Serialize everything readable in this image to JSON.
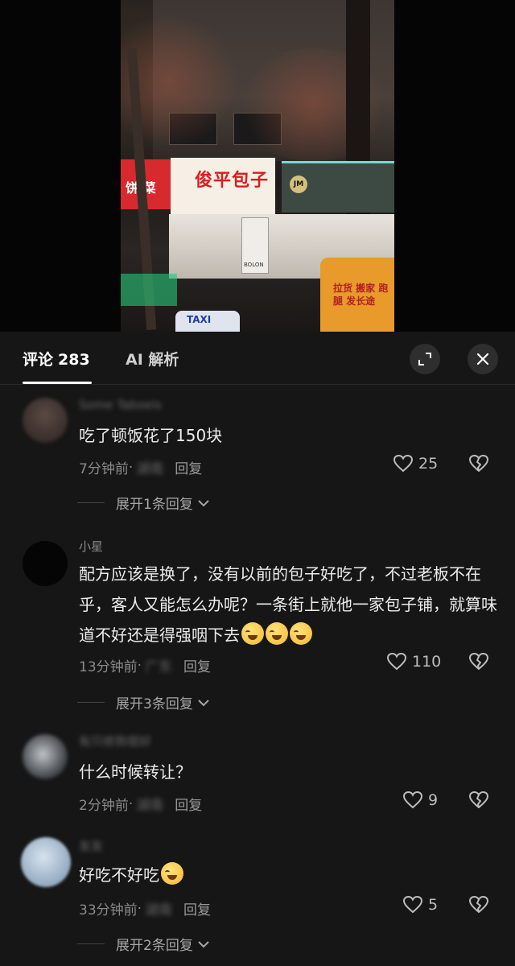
{
  "video": {
    "shop_sign": "俊平包子",
    "side_sign": "饼 菜",
    "jm_logo": "JM",
    "poster_text": "BOLON",
    "taxi_label": "TAXI",
    "bus_text": "拉货 搬家 跑腿 发长途"
  },
  "tabs": {
    "comments_label": "评论",
    "comments_count": "283",
    "ai_label": "AI 解析"
  },
  "comments": [
    {
      "user": "Some Taboeis",
      "text": "吃了顿饭花了150块",
      "time": "7分钟前",
      "location": "湖南",
      "reply_label": "回复",
      "likes": "25",
      "expand_label": "展开1条回复"
    },
    {
      "user": "小星",
      "text": "配方应该是换了，没有以前的包子好吃了，不过老板不在乎，客人又能怎么办呢？一条街上就他一家包子铺，就算味道不好还是得强咽下去",
      "time": "13分钟前",
      "location": "广东",
      "reply_label": "回复",
      "likes": "110",
      "expand_label": "展开3条回复"
    },
    {
      "user": "有只修狗很好",
      "text": "什么时候转让？",
      "time": "2分钟前",
      "location": "湖南",
      "reply_label": "回复",
      "likes": "9"
    },
    {
      "user": "友友",
      "text": "好吃不好吃",
      "time": "33分钟前",
      "location": "湖南",
      "reply_label": "回复",
      "likes": "5",
      "expand_label": "展开2条回复"
    }
  ],
  "icons": {
    "expand": "fullscreen-icon",
    "close": "close-icon",
    "like": "heart-icon",
    "dislike": "broken-heart-icon",
    "chevron": "chevron-down-icon",
    "emoji": "crying-face-icon"
  },
  "colors": {
    "background": "#161616",
    "text": "#ececec",
    "muted": "#8a8a8a"
  }
}
